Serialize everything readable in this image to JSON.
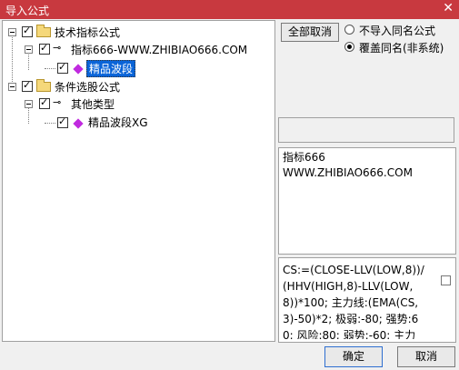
{
  "window": {
    "title": "导入公式",
    "close_glyph": "✕"
  },
  "tree": {
    "items": [
      {
        "label": "技术指标公式"
      },
      {
        "label": "指标666-WWW.ZHIBIAO666.COM"
      },
      {
        "label": "精品波段"
      },
      {
        "label": "条件选股公式"
      },
      {
        "label": "其他类型"
      },
      {
        "label": "精品波段XG"
      }
    ]
  },
  "options": {
    "deselect_all": "全部取消",
    "radio_skip": "不导入同名公式",
    "radio_overwrite": "覆盖同名(非系统)"
  },
  "description": {
    "text": "指标666\nWWW.ZHIBIAO666.COM"
  },
  "formula": {
    "text": "CS:=(CLOSE-LLV(LOW,8))/(HHV(HIGH,8)-LLV(LOW,8))*100; 主力线:(EMA(CS,3)-50)*2; 极弱:-80; 强势:60; 风险:80; 弱势:-60; 主力"
  },
  "footer": {
    "ok": "确定",
    "cancel": "取消"
  }
}
